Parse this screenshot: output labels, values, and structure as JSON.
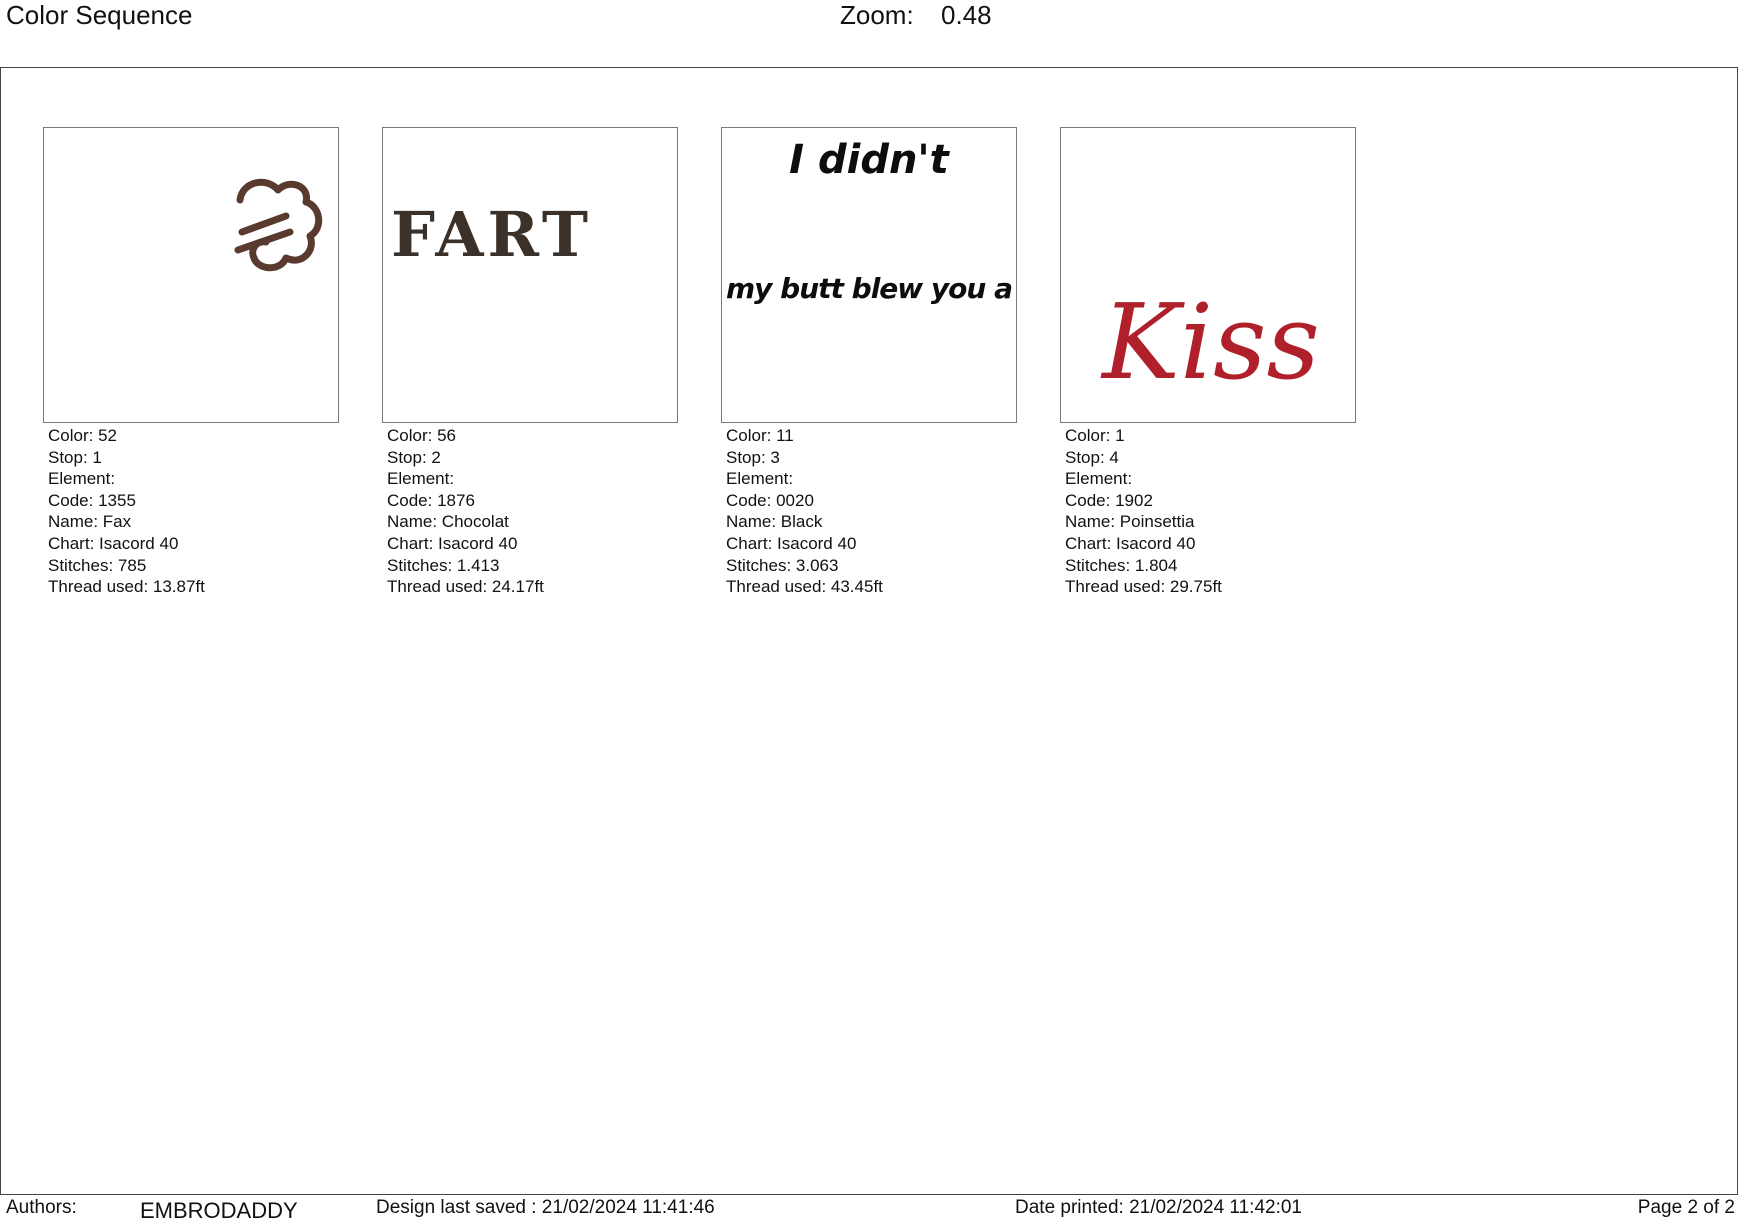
{
  "header": {
    "title": "Color Sequence",
    "zoom_label": "Zoom:",
    "zoom_value": "0.48"
  },
  "swatches": [
    {
      "color": "Color: 52",
      "stop": "Stop: 1",
      "element": "Element:",
      "code": "Code: 1355",
      "name": "Name: Fax",
      "chart": "Chart: Isacord 40",
      "stitches": "Stitches: 785",
      "thread": "Thread used: 13.87ft",
      "thread_color": "#5a3a2e",
      "icon": "wind-puff-icon"
    },
    {
      "color": "Color: 56",
      "stop": "Stop: 2",
      "element": "Element:",
      "code": "Code: 1876",
      "name": "Name: Chocolat",
      "chart": "Chart: Isacord 40",
      "stitches": "Stitches: 1.413",
      "thread": "Thread used: 24.17ft",
      "thread_color": "#3b3128",
      "text": "FART"
    },
    {
      "color": "Color: 11",
      "stop": "Stop: 3",
      "element": "Element:",
      "code": "Code: 0020",
      "name": "Name: Black",
      "chart": "Chart: Isacord 40",
      "stitches": "Stitches: 3.063",
      "thread": "Thread used: 43.45ft",
      "thread_color": "#0d0d0d",
      "text_line1": "I didn't",
      "text_line2": "my butt blew you a"
    },
    {
      "color": "Color: 1",
      "stop": "Stop: 4",
      "element": "Element:",
      "code": "Code: 1902",
      "name": "Name: Poinsettia",
      "chart": "Chart: Isacord 40",
      "stitches": "Stitches: 1.804",
      "thread": "Thread used: 29.75ft",
      "thread_color": "#b0202a",
      "text": "Kiss"
    }
  ],
  "footer": {
    "authors_label": "Authors:",
    "authors": "EMBRODADDY",
    "saved": "Design last saved : 21/02/2024 11:41:46",
    "printed": "Date printed: 21/02/2024 11:42:01",
    "page": "Page 2 of 2"
  }
}
